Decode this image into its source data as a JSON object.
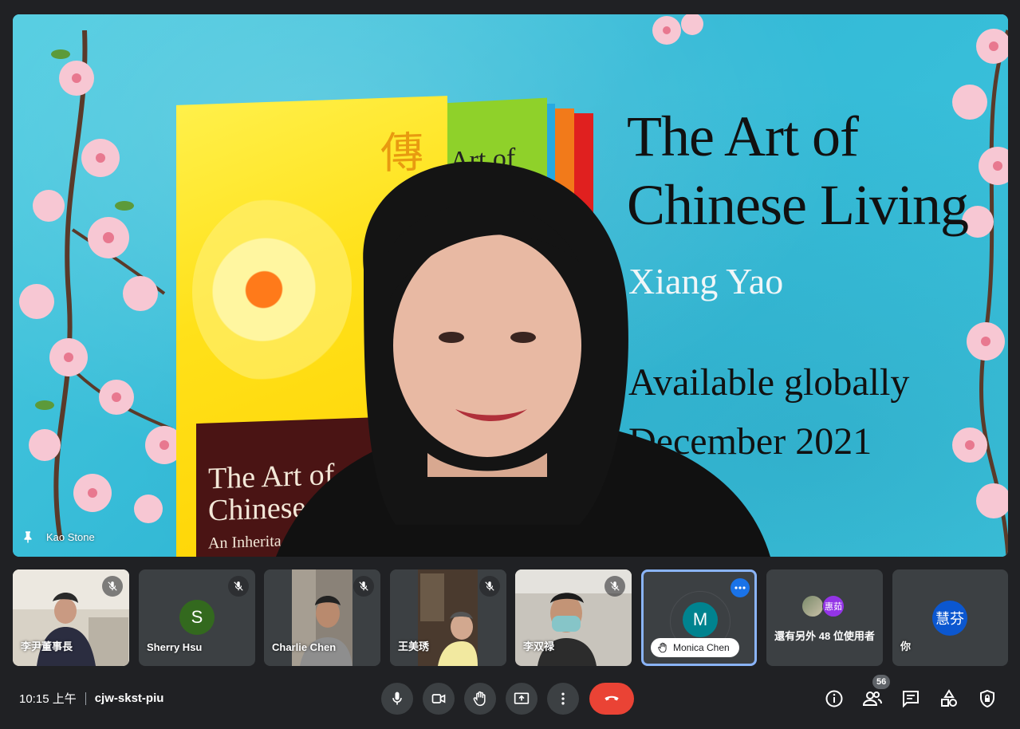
{
  "stage": {
    "speaker_name": "Kao Stone",
    "slide": {
      "title_line1": "The Art of",
      "title_line2": "Chinese Living",
      "author": "Xiang Yao",
      "avail_line1": "Available globally",
      "avail_line2": "December 2021",
      "cover_title_line1": "The Art of",
      "cover_title_line2": "Chinese Li",
      "cover_subtitle": "An Inherita",
      "cover_glyph": "傳",
      "back_book_text": "Art of"
    }
  },
  "participants": [
    {
      "name": "李尹董事長",
      "muted": true,
      "type": "video"
    },
    {
      "name": "Sherry Hsu",
      "muted": true,
      "type": "avatar",
      "initial": "S",
      "color": "#33691e"
    },
    {
      "name": "Charlie Chen",
      "muted": true,
      "type": "video"
    },
    {
      "name": "王美琇",
      "muted": true,
      "type": "video"
    },
    {
      "name": "李双禄",
      "muted": true,
      "type": "video"
    },
    {
      "name": "Monica Chen",
      "muted": false,
      "type": "avatar",
      "initial": "M",
      "color": "#00838f",
      "hand_raised": true,
      "active": true
    },
    {
      "name": "還有另外 48 位使用者",
      "type": "others",
      "mini_avatar": "惠茹",
      "mini_color": "#9334e6"
    },
    {
      "name": "你",
      "type": "avatar",
      "initial": "慧芬",
      "color": "#0b57d0"
    }
  ],
  "bottom_bar": {
    "time": "10:15 上午",
    "meeting_code": "cjw-skst-piu",
    "people_count": "56",
    "controls": [
      "mic-icon",
      "camera-icon",
      "raise-hand-icon",
      "present-icon",
      "more-options-icon",
      "hang-up-icon"
    ],
    "right_controls": [
      "info-icon",
      "people-icon",
      "chat-icon",
      "activities-icon",
      "host-controls-icon"
    ]
  },
  "colors": {
    "background": "#202124",
    "tile": "#3c4043",
    "hangup": "#ea4335",
    "active_border": "#8ab4f8"
  }
}
